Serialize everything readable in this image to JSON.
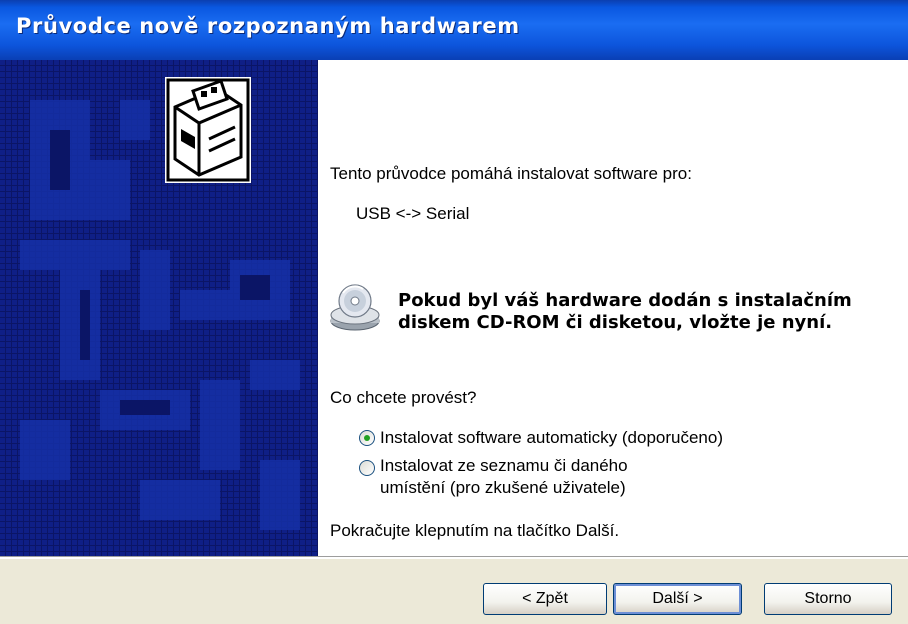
{
  "window": {
    "title": "Průvodce nově rozpoznaným hardwarem"
  },
  "content": {
    "intro": "Tento průvodce pomáhá instalovat software pro:",
    "device": "USB <-> Serial",
    "cd_prompt_line1": "Pokud byl váš hardware dodán s instalačním",
    "cd_prompt_line2": "diskem CD-ROM či disketou, vložte je nyní.",
    "question": "Co chcete provést?",
    "options": [
      {
        "label": "Instalovat software automaticky (doporučeno)",
        "selected": true
      },
      {
        "label_line1": "Instalovat ze seznamu či daného",
        "label_line2": "umístění (pro zkušené uživatele)",
        "selected": false
      }
    ],
    "continue_hint": "Pokračujte klepnutím na tlačítko Další."
  },
  "buttons": {
    "back": "< Zpět",
    "next": "Další >",
    "cancel": "Storno"
  },
  "icons": {
    "wizard": "hardware-wizard-icon",
    "cd": "cd-rom-icon"
  },
  "colors": {
    "titlebar": "#0a57e0",
    "sidebar": "#0b1566",
    "selected_radio": "#21a121"
  }
}
